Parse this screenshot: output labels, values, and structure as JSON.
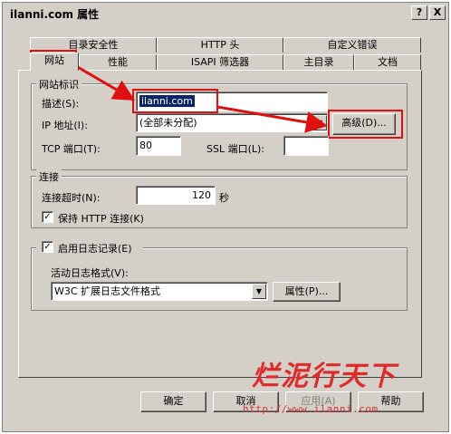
{
  "window": {
    "title": "ilanni.com 属性",
    "help_btn": "?",
    "close_btn": "X"
  },
  "tabs_back": [
    {
      "label": "目录安全性"
    },
    {
      "label": "HTTP 头"
    },
    {
      "label": "自定义错误"
    }
  ],
  "tabs_front": [
    {
      "label": "网站",
      "active": true
    },
    {
      "label": "性能"
    },
    {
      "label": "ISAPI 筛选器"
    },
    {
      "label": "主目录"
    },
    {
      "label": "文档"
    }
  ],
  "site_id": {
    "group_label": "网站标识",
    "desc_label": "描述(S):",
    "desc_value": "ilanni.com",
    "ip_label": "IP 地址(I):",
    "ip_value": "(全部未分配)",
    "advanced_btn": "高级(D)...",
    "tcp_label": "TCP 端口(T):",
    "tcp_value": "80",
    "ssl_label": "SSL 端口(L):",
    "ssl_value": ""
  },
  "connection": {
    "group_label": "连接",
    "timeout_label": "连接超时(N):",
    "timeout_value": "120",
    "timeout_unit": "秒",
    "keepalive_label": "保持 HTTP 连接(K)",
    "keepalive_checked": true
  },
  "logging": {
    "enable_label": "启用日志记录(E)",
    "enable_checked": true,
    "format_label": "活动日志格式(V):",
    "format_value": "W3C 扩展日志文件格式",
    "props_btn": "属性(P)..."
  },
  "buttons": {
    "ok": "确定",
    "cancel": "取消",
    "apply": "应用(A)",
    "help": "帮助"
  },
  "watermark": {
    "brand": "烂泥行天下",
    "url": "http://www.ilanni.com"
  },
  "colors": {
    "highlight": "#e01010",
    "selection": "#0a246a",
    "dialog_bg": "#d4d0c8"
  }
}
